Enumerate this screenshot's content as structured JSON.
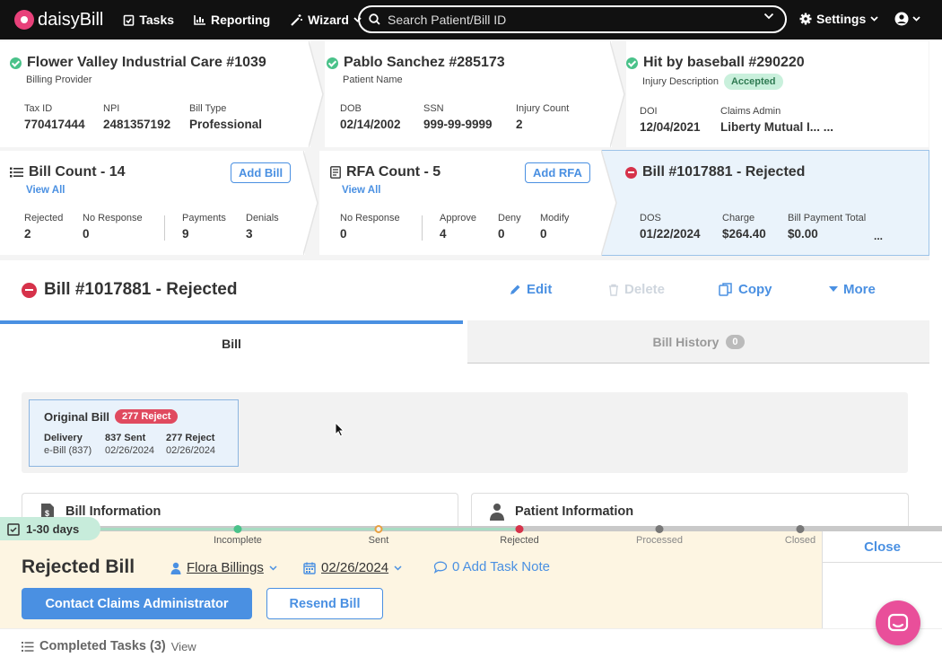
{
  "nav": {
    "logo": "daisyBill",
    "tasks": "Tasks",
    "reporting": "Reporting",
    "wizard": "Wizard",
    "search_placeholder": "Search Patient/Bill ID",
    "settings": "Settings"
  },
  "provider": {
    "title": "Flower Valley Industrial Care #1039",
    "subtitle": "Billing Provider",
    "fields": [
      {
        "label": "Tax ID",
        "value": "770417444"
      },
      {
        "label": "NPI",
        "value": "2481357192"
      },
      {
        "label": "Bill Type",
        "value": "Professional"
      }
    ]
  },
  "patient": {
    "title": "Pablo Sanchez #285173",
    "subtitle": "Patient Name",
    "fields": [
      {
        "label": "DOB",
        "value": "02/14/2002"
      },
      {
        "label": "SSN",
        "value": "999-99-9999"
      },
      {
        "label": "Injury Count",
        "value": "2"
      }
    ]
  },
  "injury": {
    "title": "Hit by baseball #290220",
    "subtitle": "Injury Description",
    "status": "Accepted",
    "fields": [
      {
        "label": "DOI",
        "value": "12/04/2021"
      },
      {
        "label": "Claims Admin",
        "value": "Liberty Mutual I... ..."
      }
    ]
  },
  "bill_count": {
    "title": "Bill Count - 14",
    "add": "Add Bill",
    "view_all": "View All",
    "fields": [
      {
        "label": "Rejected",
        "value": "2"
      },
      {
        "label": "No Response",
        "value": "0"
      },
      {
        "label": "Payments",
        "value": "9"
      },
      {
        "label": "Denials",
        "value": "3"
      }
    ]
  },
  "rfa_count": {
    "title": "RFA Count - 5",
    "add": "Add RFA",
    "view_all": "View All",
    "fields": [
      {
        "label": "No Response",
        "value": "0"
      },
      {
        "label": "Approve",
        "value": "4"
      },
      {
        "label": "Deny",
        "value": "0"
      },
      {
        "label": "Modify",
        "value": "0"
      }
    ]
  },
  "bill_card": {
    "title": "Bill #1017881 - Rejected",
    "fields": [
      {
        "label": "DOS",
        "value": "01/22/2024"
      },
      {
        "label": "Charge",
        "value": "$264.40"
      },
      {
        "label": "Bill Payment Total",
        "value": "$0.00"
      }
    ],
    "more": "..."
  },
  "bill_header": {
    "title": "Bill #1017881 - Rejected",
    "edit": "Edit",
    "delete": "Delete",
    "copy": "Copy",
    "more": "More"
  },
  "tabs": {
    "bill": "Bill",
    "history": "Bill History",
    "history_count": "0"
  },
  "original_bill": {
    "title": "Original Bill",
    "tag": "277 Reject",
    "cols": [
      {
        "head": "Delivery",
        "value": "e-Bill (837)"
      },
      {
        "head": "837 Sent",
        "value": "02/26/2024"
      },
      {
        "head": "277 Reject",
        "value": "02/26/2024"
      }
    ]
  },
  "sections": {
    "bill_info": "Bill Information",
    "patient_info": "Patient Information"
  },
  "task": {
    "days": "1-30 days",
    "steps": [
      "Incomplete",
      "Sent",
      "Rejected",
      "Processed",
      "Closed"
    ],
    "title": "Rejected Bill",
    "assignee": "Flora Billings",
    "date": "02/26/2024",
    "note": "0 Add Task Note",
    "primary_action": "Contact Claims Administrator",
    "secondary_action": "Resend Bill",
    "close": "Close"
  },
  "footer": {
    "completed": "Completed Tasks (3)",
    "view": "View"
  },
  "colors": {
    "accent": "#4a90e2",
    "reject": "#d6324a",
    "success": "#4ac28a",
    "task_bg": "#fdf5e2"
  }
}
